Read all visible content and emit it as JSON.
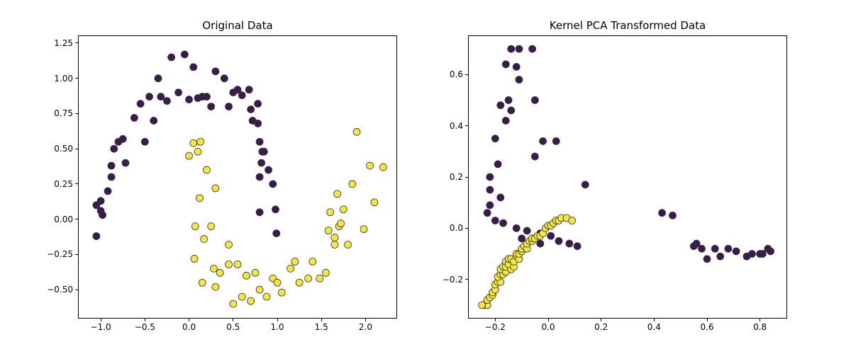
{
  "chart_data": [
    {
      "type": "scatter",
      "title": "Original Data",
      "xlabel": "",
      "ylabel": "",
      "xlim": [
        -1.25,
        2.35
      ],
      "ylim": [
        -0.7,
        1.3
      ],
      "xticks": [
        -1.0,
        -0.5,
        0.0,
        0.5,
        1.0,
        1.5,
        2.0
      ],
      "yticks": [
        -0.5,
        -0.25,
        0.0,
        0.25,
        0.5,
        0.75,
        1.0,
        1.25
      ],
      "xtick_labels": [
        "−1.0",
        "−0.5",
        "0.0",
        "0.5",
        "1.0",
        "1.5",
        "2.0"
      ],
      "ytick_labels": [
        "−0.50",
        "−0.25",
        "0.00",
        "0.25",
        "0.50",
        "0.75",
        "1.00",
        "1.25"
      ],
      "colors": {
        "class0": "#3b1b4e",
        "class1": "#f2e63f",
        "edge": "#333333"
      },
      "series": [
        {
          "name": "class0",
          "points": [
            [
              -1.05,
              0.1
            ],
            [
              -1.05,
              -0.12
            ],
            [
              -1.0,
              0.06
            ],
            [
              -1.0,
              0.13
            ],
            [
              -0.98,
              0.03
            ],
            [
              -0.92,
              0.2
            ],
            [
              -0.88,
              0.38
            ],
            [
              -0.85,
              0.5
            ],
            [
              -0.8,
              0.55
            ],
            [
              -0.75,
              0.57
            ],
            [
              -0.72,
              0.4
            ],
            [
              -0.62,
              0.72
            ],
            [
              -0.55,
              0.82
            ],
            [
              -0.5,
              0.55
            ],
            [
              -0.45,
              0.87
            ],
            [
              -0.4,
              0.7
            ],
            [
              -0.35,
              1.0
            ],
            [
              -0.32,
              0.87
            ],
            [
              -0.25,
              0.84
            ],
            [
              -0.2,
              1.15
            ],
            [
              -0.12,
              0.9
            ],
            [
              -0.05,
              1.17
            ],
            [
              0.0,
              0.85
            ],
            [
              0.05,
              1.08
            ],
            [
              0.1,
              0.86
            ],
            [
              0.15,
              0.87
            ],
            [
              0.2,
              0.87
            ],
            [
              0.25,
              0.8
            ],
            [
              0.3,
              1.05
            ],
            [
              0.4,
              1.0
            ],
            [
              0.45,
              0.8
            ],
            [
              0.5,
              0.9
            ],
            [
              0.55,
              0.92
            ],
            [
              0.6,
              0.88
            ],
            [
              0.68,
              0.92
            ],
            [
              0.7,
              0.78
            ],
            [
              0.78,
              0.82
            ],
            [
              0.78,
              0.68
            ],
            [
              0.8,
              0.55
            ],
            [
              0.8,
              0.3
            ],
            [
              0.82,
              0.4
            ],
            [
              0.83,
              0.48
            ],
            [
              0.85,
              0.48
            ],
            [
              0.9,
              0.35
            ],
            [
              0.95,
              0.25
            ],
            [
              0.98,
              0.07
            ],
            [
              0.99,
              -0.1
            ],
            [
              0.8,
              0.05
            ],
            [
              0.72,
              0.7
            ],
            [
              -0.88,
              0.3
            ]
          ]
        },
        {
          "name": "class1",
          "points": [
            [
              0.0,
              0.45
            ],
            [
              0.05,
              0.54
            ],
            [
              0.06,
              -0.28
            ],
            [
              0.07,
              -0.05
            ],
            [
              0.1,
              0.48
            ],
            [
              0.12,
              0.15
            ],
            [
              0.13,
              0.55
            ],
            [
              0.15,
              -0.45
            ],
            [
              0.17,
              -0.14
            ],
            [
              0.2,
              0.35
            ],
            [
              0.25,
              -0.05
            ],
            [
              0.28,
              -0.35
            ],
            [
              0.3,
              0.22
            ],
            [
              0.3,
              -0.48
            ],
            [
              0.35,
              -0.38
            ],
            [
              0.45,
              -0.32
            ],
            [
              0.45,
              -0.18
            ],
            [
              0.5,
              -0.6
            ],
            [
              0.55,
              -0.32
            ],
            [
              0.6,
              -0.55
            ],
            [
              0.65,
              -0.4
            ],
            [
              0.7,
              -0.58
            ],
            [
              0.75,
              -0.38
            ],
            [
              0.8,
              -0.5
            ],
            [
              0.88,
              -0.55
            ],
            [
              0.95,
              -0.42
            ],
            [
              1.0,
              -0.45
            ],
            [
              1.05,
              -0.52
            ],
            [
              1.15,
              -0.35
            ],
            [
              1.2,
              -0.3
            ],
            [
              1.25,
              -0.45
            ],
            [
              1.35,
              -0.42
            ],
            [
              1.4,
              -0.3
            ],
            [
              1.48,
              -0.42
            ],
            [
              1.55,
              -0.38
            ],
            [
              1.6,
              0.05
            ],
            [
              1.58,
              -0.08
            ],
            [
              1.65,
              -0.18
            ],
            [
              1.65,
              -0.13
            ],
            [
              1.68,
              0.18
            ],
            [
              1.7,
              -0.05
            ],
            [
              1.72,
              -0.03
            ],
            [
              1.75,
              0.07
            ],
            [
              1.8,
              -0.18
            ],
            [
              1.85,
              0.25
            ],
            [
              1.9,
              0.62
            ],
            [
              1.98,
              -0.07
            ],
            [
              2.05,
              0.38
            ],
            [
              2.1,
              0.12
            ],
            [
              2.2,
              0.37
            ]
          ]
        }
      ]
    },
    {
      "type": "scatter",
      "title": "Kernel PCA Transformed Data",
      "xlabel": "",
      "ylabel": "",
      "xlim": [
        -0.3,
        0.9
      ],
      "ylim": [
        -0.35,
        0.75
      ],
      "xticks": [
        -0.2,
        0.0,
        0.2,
        0.4,
        0.6,
        0.8
      ],
      "yticks": [
        -0.2,
        0.0,
        0.2,
        0.4,
        0.6
      ],
      "xtick_labels": [
        "−0.2",
        "0.0",
        "0.2",
        "0.4",
        "0.6",
        "0.8"
      ],
      "ytick_labels": [
        "−0.2",
        "0.0",
        "0.2",
        "0.4",
        "0.6"
      ],
      "colors": {
        "class0": "#3b1b4e",
        "class1": "#f2e63f",
        "edge": "#333333"
      },
      "series": [
        {
          "name": "class0",
          "points": [
            [
              -0.14,
              0.7
            ],
            [
              -0.11,
              0.7
            ],
            [
              -0.06,
              0.7
            ],
            [
              -0.16,
              0.64
            ],
            [
              -0.12,
              0.63
            ],
            [
              -0.11,
              0.58
            ],
            [
              -0.15,
              0.5
            ],
            [
              -0.05,
              0.5
            ],
            [
              -0.18,
              0.48
            ],
            [
              -0.14,
              0.46
            ],
            [
              -0.16,
              0.42
            ],
            [
              -0.2,
              0.35
            ],
            [
              -0.02,
              0.34
            ],
            [
              0.03,
              0.34
            ],
            [
              -0.05,
              0.28
            ],
            [
              -0.19,
              0.25
            ],
            [
              -0.22,
              0.2
            ],
            [
              0.14,
              0.17
            ],
            [
              -0.22,
              0.15
            ],
            [
              -0.18,
              0.12
            ],
            [
              -0.22,
              0.09
            ],
            [
              -0.23,
              0.06
            ],
            [
              0.43,
              0.06
            ],
            [
              0.47,
              0.05
            ],
            [
              -0.2,
              0.03
            ],
            [
              -0.17,
              0.02
            ],
            [
              -0.12,
              0.0
            ],
            [
              -0.08,
              -0.01
            ],
            [
              -0.03,
              -0.02
            ],
            [
              0.01,
              -0.03
            ],
            [
              -0.04,
              -0.03
            ],
            [
              0.04,
              -0.05
            ],
            [
              -0.03,
              -0.06
            ],
            [
              0.08,
              -0.06
            ],
            [
              0.56,
              -0.06
            ],
            [
              0.55,
              -0.07
            ],
            [
              0.11,
              -0.07
            ],
            [
              0.63,
              -0.08
            ],
            [
              0.68,
              -0.08
            ],
            [
              0.58,
              -0.08
            ],
            [
              0.71,
              -0.09
            ],
            [
              0.77,
              -0.1
            ],
            [
              0.81,
              -0.1
            ],
            [
              0.8,
              -0.1
            ],
            [
              0.83,
              -0.08
            ],
            [
              0.84,
              -0.09
            ],
            [
              0.75,
              -0.11
            ],
            [
              0.65,
              -0.11
            ],
            [
              0.6,
              -0.12
            ],
            [
              -0.1,
              -0.04
            ]
          ]
        },
        {
          "name": "class1",
          "points": [
            [
              -0.24,
              -0.3
            ],
            [
              -0.23,
              -0.3
            ],
            [
              -0.25,
              -0.3
            ],
            [
              -0.23,
              -0.28
            ],
            [
              -0.22,
              -0.27
            ],
            [
              -0.21,
              -0.26
            ],
            [
              -0.21,
              -0.25
            ],
            [
              -0.2,
              -0.24
            ],
            [
              -0.2,
              -0.22
            ],
            [
              -0.19,
              -0.21
            ],
            [
              -0.18,
              -0.21
            ],
            [
              -0.19,
              -0.19
            ],
            [
              -0.18,
              -0.18
            ],
            [
              -0.17,
              -0.18
            ],
            [
              -0.18,
              -0.16
            ],
            [
              -0.16,
              -0.17
            ],
            [
              -0.17,
              -0.15
            ],
            [
              -0.16,
              -0.15
            ],
            [
              -0.14,
              -0.16
            ],
            [
              -0.16,
              -0.13
            ],
            [
              -0.15,
              -0.14
            ],
            [
              -0.13,
              -0.15
            ],
            [
              -0.15,
              -0.12
            ],
            [
              -0.14,
              -0.12
            ],
            [
              -0.13,
              -0.13
            ],
            [
              -0.12,
              -0.11
            ],
            [
              -0.12,
              -0.1
            ],
            [
              -0.11,
              -0.12
            ],
            [
              -0.11,
              -0.1
            ],
            [
              -0.1,
              -0.09
            ],
            [
              -0.1,
              -0.08
            ],
            [
              -0.09,
              -0.07
            ],
            [
              -0.08,
              -0.08
            ],
            [
              -0.08,
              -0.06
            ],
            [
              -0.07,
              -0.05
            ],
            [
              -0.06,
              -0.05
            ],
            [
              -0.06,
              -0.04
            ],
            [
              -0.05,
              -0.04
            ],
            [
              -0.04,
              -0.03
            ],
            [
              -0.03,
              -0.03
            ],
            [
              -0.02,
              -0.02
            ],
            [
              -0.01,
              0.0
            ],
            [
              0.0,
              0.01
            ],
            [
              0.01,
              0.01
            ],
            [
              0.02,
              0.02
            ],
            [
              0.03,
              0.03
            ],
            [
              0.04,
              0.03
            ],
            [
              0.05,
              0.04
            ],
            [
              0.07,
              0.04
            ],
            [
              0.09,
              0.03
            ]
          ]
        }
      ]
    }
  ]
}
